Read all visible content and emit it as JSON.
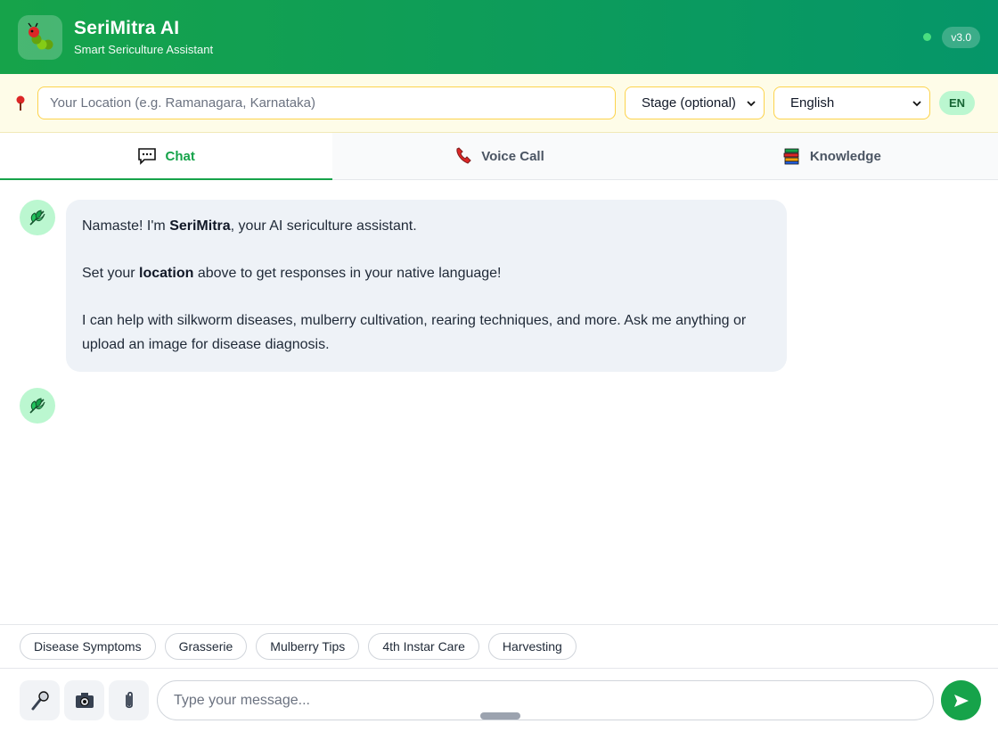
{
  "header": {
    "title": "SeriMitra AI",
    "subtitle": "Smart Sericulture Assistant",
    "version": "v3.0"
  },
  "location_bar": {
    "location_placeholder": "Your Location (e.g. Ramanagara, Karnataka)",
    "stage_selected": "Stage (optional)",
    "language_selected": "English",
    "language_badge": "EN"
  },
  "tabs": [
    {
      "label": "Chat",
      "icon": "chat-icon",
      "active": true
    },
    {
      "label": "Voice Call",
      "icon": "phone-icon",
      "active": false
    },
    {
      "label": "Knowledge",
      "icon": "books-icon",
      "active": false
    }
  ],
  "messages": {
    "welcome": {
      "line1_prefix": "Namaste! I'm ",
      "line1_bold": "SeriMitra",
      "line1_suffix": ", your AI sericulture assistant.",
      "line2_prefix": "Set your ",
      "line2_bold": "location",
      "line2_suffix": " above to get responses in your native language!",
      "line3": "I can help with silkworm diseases, mulberry cultivation, rearing techniques, and more. Ask me anything or upload an image for disease diagnosis."
    }
  },
  "quick_replies": [
    "Disease Symptoms",
    "Grasserie",
    "Mulberry Tips",
    "4th Instar Care",
    "Harvesting"
  ],
  "composer": {
    "placeholder": "Type your message..."
  },
  "colors": {
    "brand_green": "#16a34a",
    "header_gradient_end": "#059669",
    "location_bar_bg": "#fefce8",
    "bubble_bg": "#eef2f7"
  }
}
